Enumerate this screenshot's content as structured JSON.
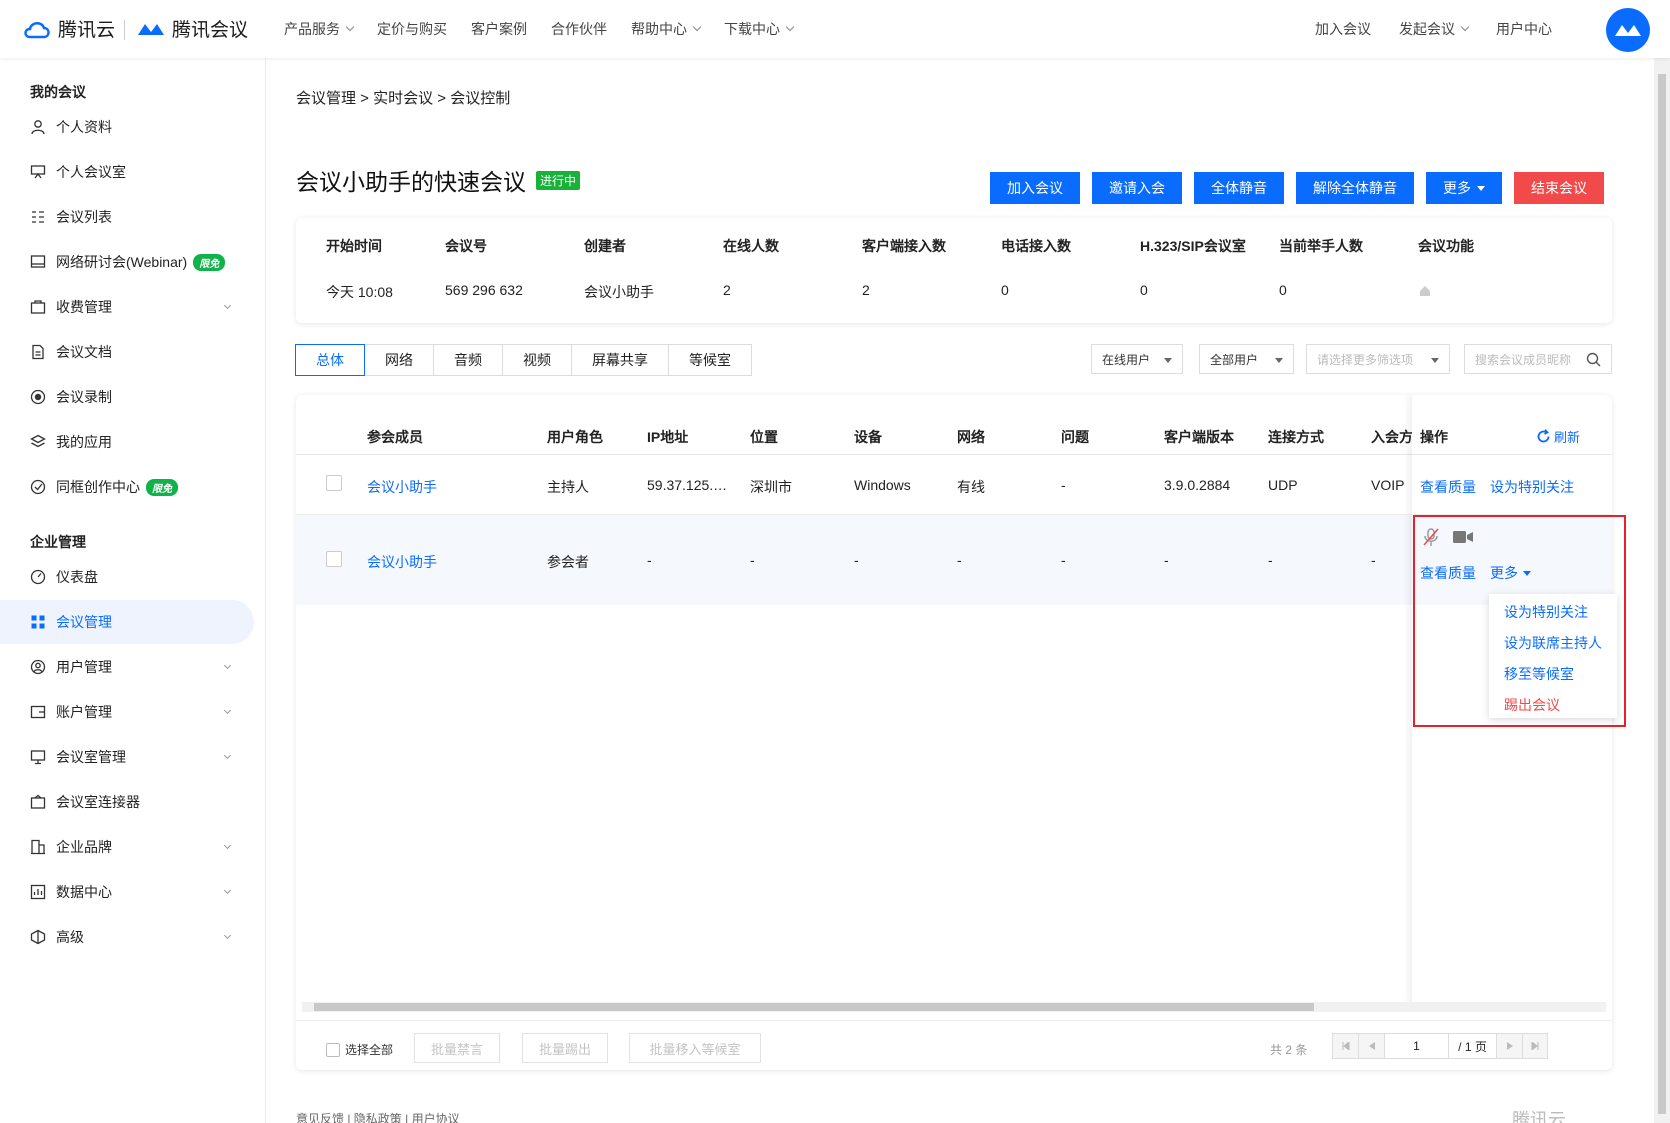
{
  "brand": {
    "cloud": "腾讯云",
    "meeting": "腾讯会议",
    "accent": "#0a6cff"
  },
  "topnav": [
    {
      "label": "产品服务",
      "dropdown": true
    },
    {
      "label": "定价与购买",
      "dropdown": false
    },
    {
      "label": "客户案例",
      "dropdown": false
    },
    {
      "label": "合作伙伴",
      "dropdown": false
    },
    {
      "label": "帮助中心",
      "dropdown": true
    },
    {
      "label": "下载中心",
      "dropdown": true
    }
  ],
  "topright": {
    "join": "加入会议",
    "start": "发起会议",
    "user_center": "用户中心"
  },
  "sidebar": {
    "section1": "我的会议",
    "section2": "企业管理",
    "items1": [
      {
        "label": "个人资料",
        "icon": "user-icon"
      },
      {
        "label": "个人会议室",
        "icon": "monitor-icon"
      },
      {
        "label": "会议列表",
        "icon": "list-icon"
      },
      {
        "label": "网络研讨会(Webinar)",
        "icon": "webinar-icon",
        "badge": "限免"
      },
      {
        "label": "收费管理",
        "icon": "wallet-icon",
        "chevron": true
      },
      {
        "label": "会议文档",
        "icon": "document-icon"
      },
      {
        "label": "会议录制",
        "icon": "record-icon"
      },
      {
        "label": "我的应用",
        "icon": "apps-icon"
      },
      {
        "label": "同框创作中心",
        "icon": "create-icon",
        "badge": "限免"
      }
    ],
    "items2": [
      {
        "label": "仪表盘",
        "icon": "dashboard-icon"
      },
      {
        "label": "会议管理",
        "icon": "grid-icon",
        "active": true
      },
      {
        "label": "用户管理",
        "icon": "users-icon",
        "chevron": true
      },
      {
        "label": "账户管理",
        "icon": "account-icon",
        "chevron": true
      },
      {
        "label": "会议室管理",
        "icon": "room-icon",
        "chevron": true
      },
      {
        "label": "会议室连接器",
        "icon": "connector-icon"
      },
      {
        "label": "企业品牌",
        "icon": "brand-icon",
        "chevron": true
      },
      {
        "label": "数据中心",
        "icon": "data-icon",
        "chevron": true
      },
      {
        "label": "高级",
        "icon": "advanced-icon",
        "chevron": true
      }
    ]
  },
  "breadcrumb": "会议管理 > 实时会议 > 会议控制",
  "meeting": {
    "title": "会议小助手的快速会议",
    "status": "进行中"
  },
  "actions": {
    "join": "加入会议",
    "invite": "邀请入会",
    "mute_all": "全体静音",
    "unmute_all": "解除全体静音",
    "more": "更多",
    "end": "结束会议"
  },
  "info": {
    "labels": [
      "开始时间",
      "会议号",
      "创建者",
      "在线人数",
      "客户端接入数",
      "电话接入数",
      "H.323/SIP会议室",
      "当前举手人数",
      "会议功能"
    ],
    "values": [
      "今天   10:08",
      "569 296 632",
      "会议小助手",
      "2",
      "2",
      "0",
      "0",
      "0",
      ""
    ]
  },
  "tabs": [
    "总体",
    "网络",
    "音频",
    "视频",
    "屏幕共享",
    "等候室"
  ],
  "filters": {
    "online": "在线用户",
    "all_users": "全部用户",
    "more_placeholder": "请选择更多筛选项",
    "search_placeholder": "搜索会议成员昵称"
  },
  "table": {
    "headers": [
      "参会成员",
      "用户角色",
      "IP地址",
      "位置",
      "设备",
      "网络",
      "问题",
      "客户端版本",
      "连接方式",
      "入会方"
    ],
    "ops_header": "操作",
    "refresh": "刷新",
    "rows": [
      [
        "会议小助手",
        "主持人",
        "59.37.125.…",
        "深圳市",
        "Windows",
        "有线",
        "-",
        "3.9.0.2884",
        "UDP",
        "VOIP"
      ],
      [
        "会议小助手",
        "参会者",
        "-",
        "-",
        "-",
        "-",
        "-",
        "-",
        "-",
        "-"
      ]
    ],
    "row1_ops": {
      "quality": "查看质量",
      "special": "设为特别关注"
    },
    "row2_ops": {
      "quality": "查看质量",
      "more": "更多"
    }
  },
  "dropdown": {
    "special": "设为特别关注",
    "cohost": "设为联席主持人",
    "waiting": "移至等候室",
    "kick": "踢出会议"
  },
  "footer": {
    "select_all": "选择全部",
    "batch_mute": "批量禁言",
    "batch_kick": "批量踢出",
    "batch_waiting": "批量移入等候室",
    "total": "共 2 条",
    "page": "1",
    "pages": "/ 1 页"
  },
  "page_footer": {
    "links": "意见反馈 | 隐私政策 | 用户协议",
    "logo": "腾讯云"
  }
}
